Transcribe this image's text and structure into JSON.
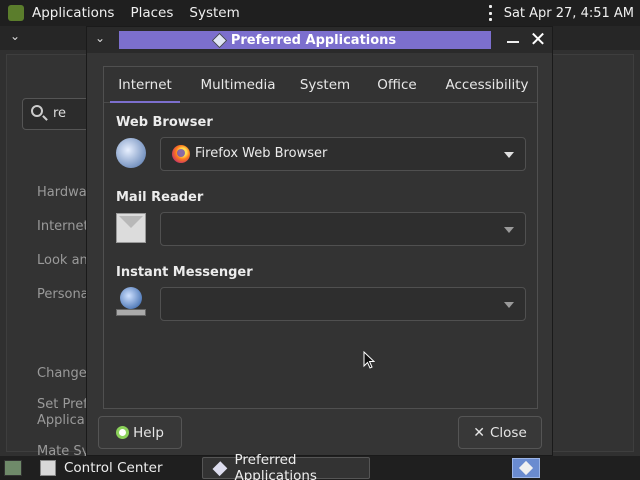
{
  "top_panel": {
    "menus": [
      "Applications",
      "Places",
      "System"
    ],
    "clock": "Sat Apr 27,  4:51 AM"
  },
  "background_window": {
    "search_value": "re",
    "categories": [
      "Hardwa",
      "Internet",
      "Look an",
      "Persona",
      "Change",
      "Set Pref",
      "Applica",
      "Mate Sy"
    ]
  },
  "dialog": {
    "title": "Preferred Applications",
    "tabs": [
      "Internet",
      "Multimedia",
      "System",
      "Office",
      "Accessibility"
    ],
    "active_tab": "Internet",
    "sections": {
      "web_browser": {
        "label": "Web Browser",
        "value": "Firefox Web Browser"
      },
      "mail_reader": {
        "label": "Mail Reader",
        "value": ""
      },
      "instant_messenger": {
        "label": "Instant Messenger",
        "value": ""
      }
    },
    "help_label": "Help",
    "close_label": "Close"
  },
  "taskbar": {
    "items": [
      "Control Center",
      "Preferred Applications"
    ]
  }
}
